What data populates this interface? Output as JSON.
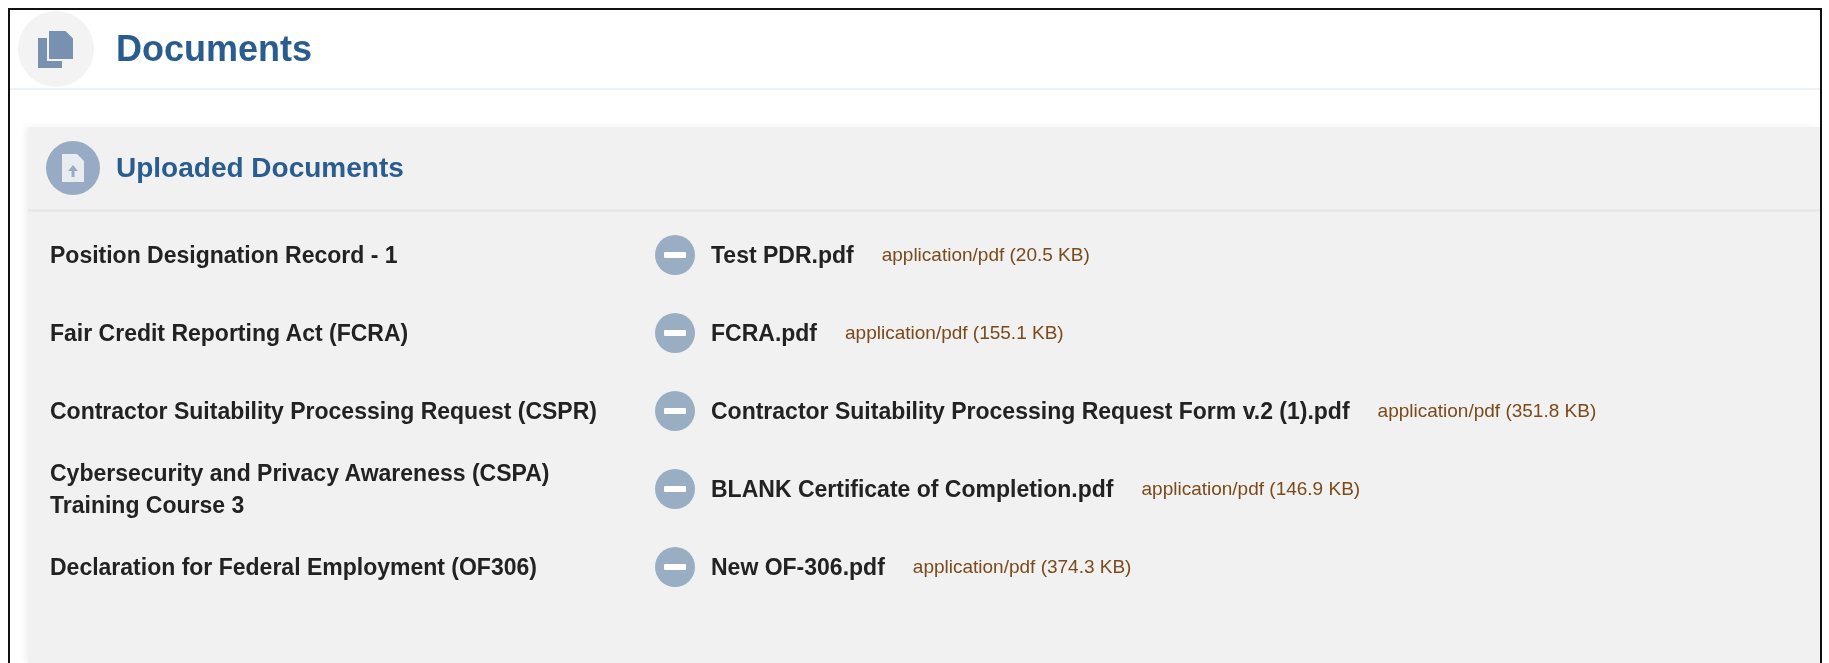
{
  "page": {
    "title": "Documents"
  },
  "panel": {
    "title": "Uploaded Documents",
    "rows": [
      {
        "label": "Position Designation Record - 1",
        "file": "Test PDR.pdf",
        "meta": "application/pdf (20.5 KB)"
      },
      {
        "label": "Fair Credit Reporting Act (FCRA)",
        "file": "FCRA.pdf",
        "meta": "application/pdf (155.1 KB)"
      },
      {
        "label": "Contractor Suitability Processing Request (CSPR)",
        "file": "Contractor Suitability Processing Request Form v.2 (1).pdf",
        "meta": "application/pdf (351.8 KB)"
      },
      {
        "label": "Cybersecurity and Privacy Awareness (CSPA) Training Course 3",
        "file": "BLANK Certificate of Completion.pdf",
        "meta": "application/pdf (146.9 KB)"
      },
      {
        "label": "Declaration for Federal Employment (OF306)",
        "file": "New OF-306.pdf",
        "meta": "application/pdf (374.3 KB)"
      }
    ]
  }
}
